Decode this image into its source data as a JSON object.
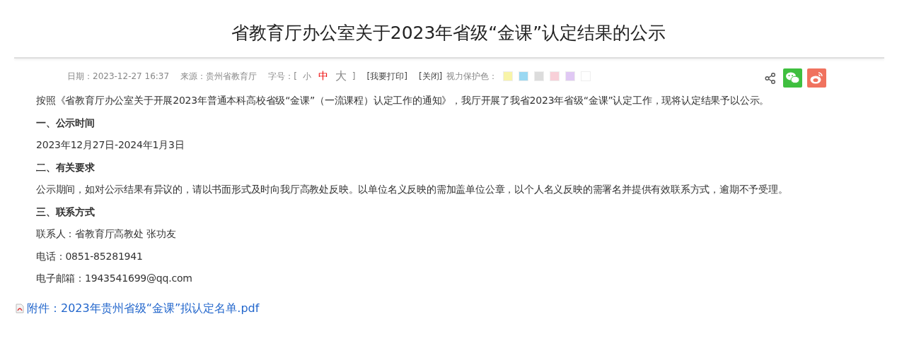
{
  "title": "省教育厅办公室关于2023年省级“金课”认定结果的公示",
  "meta": {
    "date": "日期：2023-12-27 16:37",
    "source": "来源：贵州省教育厅",
    "font_size_label": "字号：[",
    "font_sizes": [
      {
        "label": "小",
        "selected": false
      },
      {
        "label": "中",
        "selected": true
      },
      {
        "label": "大",
        "selected": false
      }
    ],
    "font_size_end": "]",
    "print": "[我要打印]",
    "close": "[关闭]",
    "eye_care_label": "视力保护色：",
    "eye_care_colors": [
      {
        "color": "#f8f4a8"
      },
      {
        "color": "#9ad8f2"
      },
      {
        "color": "#dcdcdc"
      },
      {
        "color": "#f8d0d8"
      },
      {
        "color": "#e0c8f4"
      },
      {
        "color": "#ffffff"
      }
    ]
  },
  "paragraphs": [
    {
      "kind": "text",
      "text": "按照《省教育厅办公室关于开展2023年普通本科高校省级“金课”（一流课程）认定工作的通知》，我厅开展了我省2023年省级“金课”认定工作，现将认定结果予以公示。"
    },
    {
      "kind": "heading",
      "text": "一、公示时间"
    },
    {
      "kind": "text",
      "text": "2023年12月27日-2024年1月3日"
    },
    {
      "kind": "heading",
      "text": "二、有关要求"
    },
    {
      "kind": "text",
      "text": "公示期间，如对公示结果有异议的，请以书面形式及时向我厅高教处反映。以单位名义反映的需加盖单位公章，以个人名义反映的需署名并提供有效联系方式，逾期不予受理。"
    },
    {
      "kind": "heading",
      "text": "三、联系方式"
    },
    {
      "kind": "text",
      "text": "联系人：省教育厅高教处 张功友"
    },
    {
      "kind": "text",
      "text": "电话：0851-85281941"
    },
    {
      "kind": "text",
      "text": "电子邮箱：1943541699@qq.com"
    }
  ],
  "attachment": "附件：2023年贵州省级“金课”拟认定名单.pdf"
}
